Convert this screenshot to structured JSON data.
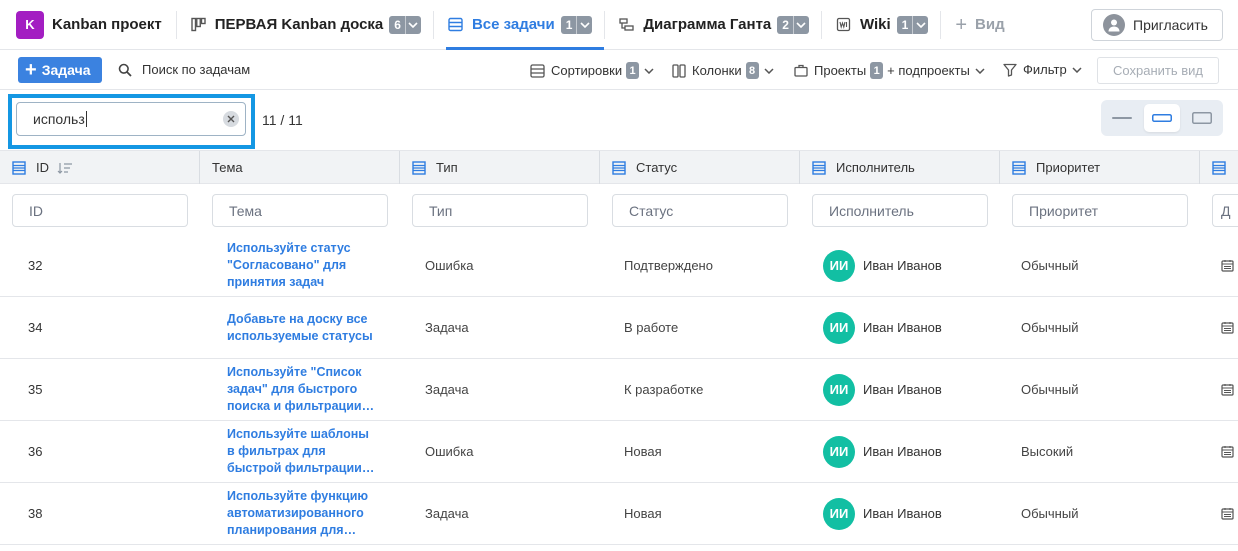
{
  "project": {
    "badge": "K",
    "name": "Kanban проект",
    "badge_color": "#a31ec2"
  },
  "tabs": [
    {
      "label": "ПЕРВАЯ Kanban доска",
      "count": "6",
      "icon": "board-icon",
      "active": false
    },
    {
      "label": "Все задачи",
      "count": "1",
      "icon": "list-icon",
      "active": true
    },
    {
      "label": "Диаграмма Ганта",
      "count": "2",
      "icon": "gantt-icon",
      "active": false
    },
    {
      "label": "Wiki",
      "count": "1",
      "icon": "wiki-icon",
      "active": false
    }
  ],
  "add_view_label": "Вид",
  "invite_label": "Пригласить",
  "toolbar": {
    "new_task_label": "Задача",
    "search_label": "Поиск по задачам",
    "sort_label": "Сортировки",
    "sort_count": "1",
    "columns_label": "Колонки",
    "columns_count": "8",
    "projects_label": "Проекты",
    "projects_count": "1",
    "projects_suffix": "+ подпроекты",
    "filter_label": "Фильтр",
    "save_view_label": "Сохранить вид"
  },
  "search": {
    "value": "использ",
    "match_count": "11 / 11"
  },
  "columns": [
    {
      "label": "ID"
    },
    {
      "label": "Тема"
    },
    {
      "label": "Тип"
    },
    {
      "label": "Статус"
    },
    {
      "label": "Исполнитель"
    },
    {
      "label": "Приоритет"
    }
  ],
  "filters": {
    "id": "ID",
    "subject": "Тема",
    "type": "Тип",
    "status": "Статус",
    "assignee": "Исполнитель",
    "priority": "Приоритет",
    "next": "Д"
  },
  "rows": [
    {
      "id": "32",
      "subject": "Используйте статус \"Согласовано\" для принятия задач",
      "type": "Ошибка",
      "status": "Подтверждено",
      "assignee_initials": "ИИ",
      "assignee": "Иван Иванов",
      "priority": "Обычный"
    },
    {
      "id": "34",
      "subject": "Добавьте на доску все используемые статусы",
      "type": "Задача",
      "status": "В работе",
      "assignee_initials": "ИИ",
      "assignee": "Иван Иванов",
      "priority": "Обычный"
    },
    {
      "id": "35",
      "subject": "Используйте \"Список задач\" для быстрого поиска и фильтрации задач",
      "type": "Задача",
      "status": "К разработке",
      "assignee_initials": "ИИ",
      "assignee": "Иван Иванов",
      "priority": "Обычный"
    },
    {
      "id": "36",
      "subject": "Используйте шаблоны в фильтрах для быстрой фильтрации задач",
      "type": "Ошибка",
      "status": "Новая",
      "assignee_initials": "ИИ",
      "assignee": "Иван Иванов",
      "priority": "Высокий"
    },
    {
      "id": "38",
      "subject": "Используйте функцию автоматизированного планирования для задач",
      "type": "Задача",
      "status": "Новая",
      "assignee_initials": "ИИ",
      "assignee": "Иван Иванов",
      "priority": "Обычный"
    }
  ],
  "colors": {
    "accent": "#2f7de1",
    "avatar": "#12bfa3",
    "highlight": "#1497e3",
    "pill": "#8d97a3"
  }
}
